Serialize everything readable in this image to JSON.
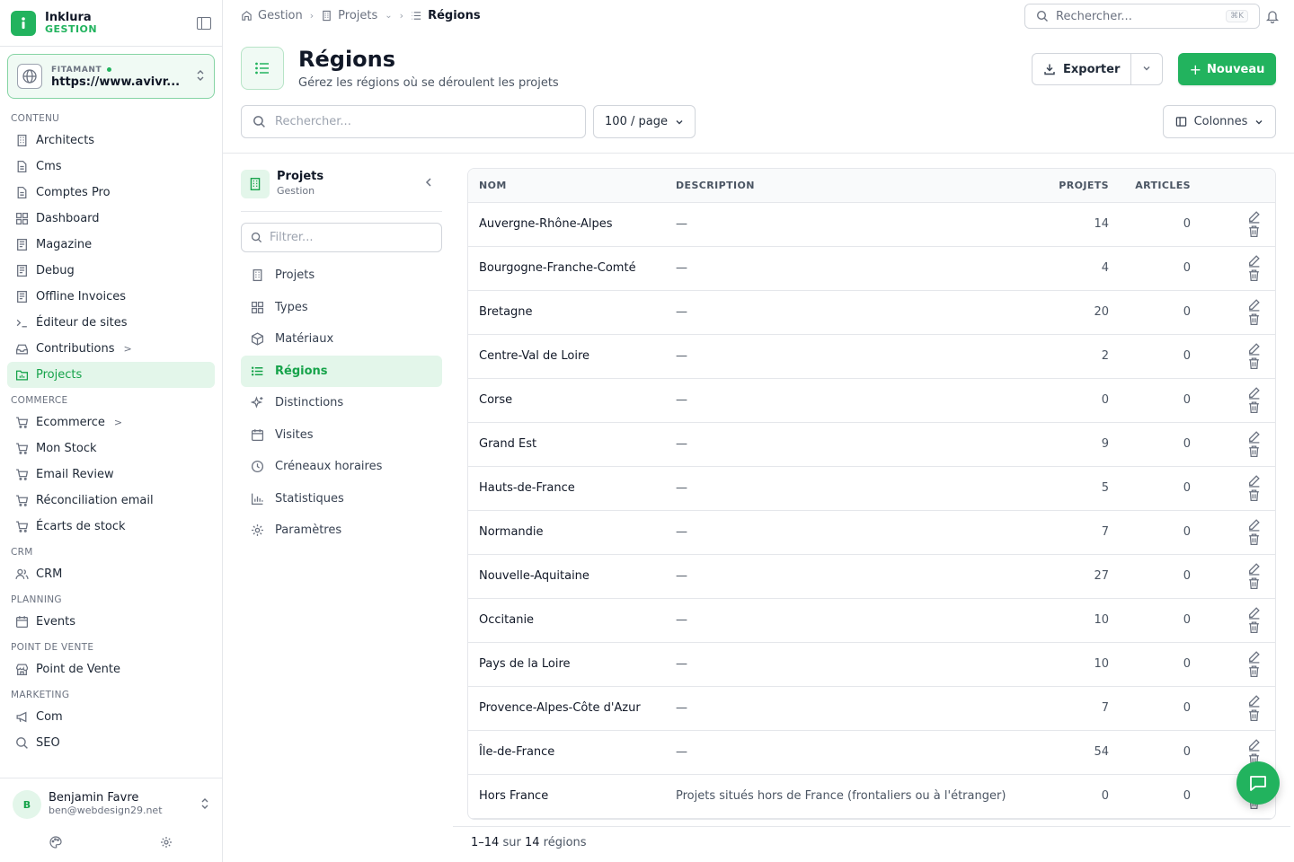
{
  "brand": {
    "name": "Inklura",
    "subtitle": "GESTION"
  },
  "site": {
    "label": "FITAMANT",
    "url": "https://www.avivr..."
  },
  "sidebar": {
    "sections": [
      {
        "title": "CONTENU",
        "items": [
          {
            "label": "Architects",
            "icon": "building-icon"
          },
          {
            "label": "Cms",
            "icon": "file-icon"
          },
          {
            "label": "Comptes Pro",
            "icon": "file-icon"
          },
          {
            "label": "Dashboard",
            "icon": "grid-icon"
          },
          {
            "label": "Magazine",
            "icon": "newspaper-icon"
          },
          {
            "label": "Debug",
            "icon": "newspaper-icon"
          },
          {
            "label": "Offline Invoices",
            "icon": "newspaper-icon"
          },
          {
            "label": "Éditeur de sites",
            "icon": "terminal-icon"
          },
          {
            "label": "Contributions",
            "icon": "inbox-icon",
            "chevron": ">"
          },
          {
            "label": "Projects",
            "icon": "folder-chart-icon",
            "active": true
          }
        ]
      },
      {
        "title": "COMMERCE",
        "items": [
          {
            "label": "Ecommerce",
            "icon": "cart-icon",
            "chevron": ">"
          },
          {
            "label": "Mon Stock",
            "icon": "cart-icon"
          },
          {
            "label": "Email Review",
            "icon": "cart-icon"
          },
          {
            "label": "Réconciliation email",
            "icon": "cart-icon"
          },
          {
            "label": "Écarts de stock",
            "icon": "cart-icon"
          }
        ]
      },
      {
        "title": "CRM",
        "items": [
          {
            "label": "CRM",
            "icon": "users-icon"
          }
        ]
      },
      {
        "title": "PLANNING",
        "items": [
          {
            "label": "Events",
            "icon": "calendar-icon"
          }
        ]
      },
      {
        "title": "POINT DE VENTE",
        "items": [
          {
            "label": "Point de Vente",
            "icon": "store-icon"
          }
        ]
      },
      {
        "title": "MARKETING",
        "items": [
          {
            "label": "Com",
            "icon": "megaphone-icon"
          },
          {
            "label": "SEO",
            "icon": "search-icon"
          }
        ]
      }
    ]
  },
  "user": {
    "initial": "B",
    "name": "Benjamin Favre",
    "email": "ben@webdesign29.net"
  },
  "breadcrumb": {
    "home": "Gestion",
    "parent": "Projets",
    "current": "Régions"
  },
  "top_search": {
    "placeholder": "Rechercher...",
    "shortcut": "⌘K"
  },
  "header": {
    "title": "Régions",
    "subtitle": "Gérez les régions où se déroulent les projets",
    "export_label": "Exporter",
    "new_label": "Nouveau"
  },
  "toolbar": {
    "search_placeholder": "Rechercher...",
    "per_page": "100 / page",
    "columns_label": "Colonnes"
  },
  "subnav": {
    "title": "Projets",
    "subtitle": "Gestion",
    "filter_placeholder": "Filtrer...",
    "items": [
      {
        "label": "Projets",
        "icon": "building-icon"
      },
      {
        "label": "Types",
        "icon": "grid-icon"
      },
      {
        "label": "Matériaux",
        "icon": "box-icon"
      },
      {
        "label": "Régions",
        "icon": "list-icon",
        "active": true
      },
      {
        "label": "Distinctions",
        "icon": "sparkles-icon"
      },
      {
        "label": "Visites",
        "icon": "calendar-icon"
      },
      {
        "label": "Créneaux horaires",
        "icon": "clock-icon"
      },
      {
        "label": "Statistiques",
        "icon": "bar-chart-icon"
      },
      {
        "label": "Paramètres",
        "icon": "gear-icon"
      }
    ]
  },
  "table": {
    "columns": [
      "NOM",
      "DESCRIPTION",
      "PROJETS",
      "ARTICLES"
    ],
    "rows": [
      {
        "name": "Auvergne-Rhône-Alpes",
        "description": "—",
        "projets": "14",
        "articles": "0"
      },
      {
        "name": "Bourgogne-Franche-Comté",
        "description": "—",
        "projets": "4",
        "articles": "0"
      },
      {
        "name": "Bretagne",
        "description": "—",
        "projets": "20",
        "articles": "0"
      },
      {
        "name": "Centre-Val de Loire",
        "description": "—",
        "projets": "2",
        "articles": "0"
      },
      {
        "name": "Corse",
        "description": "—",
        "projets": "0",
        "articles": "0"
      },
      {
        "name": "Grand Est",
        "description": "—",
        "projets": "9",
        "articles": "0"
      },
      {
        "name": "Hauts-de-France",
        "description": "—",
        "projets": "5",
        "articles": "0"
      },
      {
        "name": "Normandie",
        "description": "—",
        "projets": "7",
        "articles": "0"
      },
      {
        "name": "Nouvelle-Aquitaine",
        "description": "—",
        "projets": "27",
        "articles": "0"
      },
      {
        "name": "Occitanie",
        "description": "—",
        "projets": "10",
        "articles": "0"
      },
      {
        "name": "Pays de la Loire",
        "description": "—",
        "projets": "10",
        "articles": "0"
      },
      {
        "name": "Provence-Alpes-Côte d'Azur",
        "description": "—",
        "projets": "7",
        "articles": "0"
      },
      {
        "name": "Île-de-France",
        "description": "—",
        "projets": "54",
        "articles": "0"
      },
      {
        "name": "Hors France",
        "description": "Projets situés hors de France (frontaliers ou à l'étranger)",
        "projets": "0",
        "articles": "0"
      }
    ]
  },
  "pagination": {
    "range": "1–14",
    "sur": "sur",
    "total": "14",
    "unit": "régions"
  },
  "colors": {
    "accent": "#22b35e",
    "accent_bg": "#e3f6ea"
  }
}
